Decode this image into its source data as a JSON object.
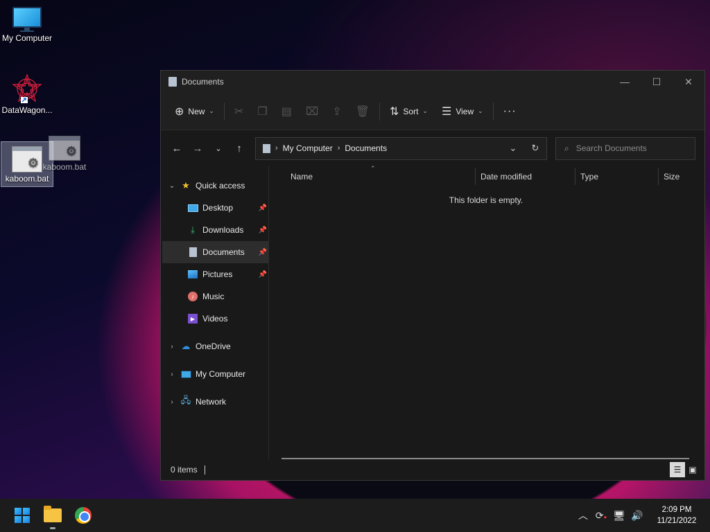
{
  "desktop": {
    "icons": [
      {
        "label": "My Computer"
      },
      {
        "label": "DataWagon..."
      },
      {
        "label": "kaboom.bat"
      },
      {
        "label": "kaboom.bat"
      }
    ]
  },
  "window": {
    "title": "Documents",
    "controls": {
      "minimize": "—",
      "maximize": "☐",
      "close": "✕"
    }
  },
  "commandbar": {
    "new_label": "New",
    "sort_label": "Sort",
    "view_label": "View",
    "more_label": "···"
  },
  "address": {
    "crumbs": [
      "My Computer",
      "Documents"
    ]
  },
  "search": {
    "placeholder": "Search Documents"
  },
  "nav_pane": {
    "quick_access": "Quick access",
    "items": [
      {
        "label": "Desktop",
        "pinned": true
      },
      {
        "label": "Downloads",
        "pinned": true
      },
      {
        "label": "Documents",
        "pinned": true,
        "selected": true
      },
      {
        "label": "Pictures",
        "pinned": true
      },
      {
        "label": "Music",
        "pinned": false
      },
      {
        "label": "Videos",
        "pinned": false
      }
    ],
    "onedrive": "OneDrive",
    "my_computer": "My Computer",
    "network": "Network"
  },
  "columns": [
    "Name",
    "Date modified",
    "Type",
    "Size"
  ],
  "content": {
    "empty_message": "This folder is empty."
  },
  "status": {
    "items_count": "0 items"
  },
  "taskbar": {
    "time": "2:09 PM",
    "date": "11/21/2022"
  },
  "colors": {
    "accent": "#4cc2ff",
    "window_bg": "#191919",
    "taskbar_bg": "#1c1c1c"
  }
}
